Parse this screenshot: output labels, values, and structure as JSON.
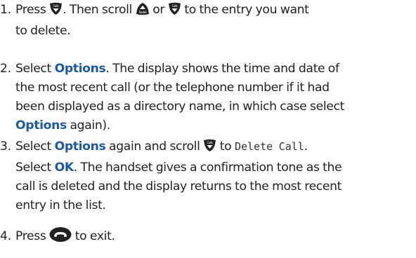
{
  "steps": [
    {
      "num": "1.",
      "line1a": "Press",
      "line1b": ". Then scroll",
      "line1c": "or",
      "line1d": "to the entry you want",
      "line2": "to delete."
    },
    {
      "num": "2.",
      "line1a": "Select",
      "kw1": "Options",
      "line1b": ". The display shows the time and date of",
      "line2": "the most recent call (or the telephone number if it had",
      "line3": "been displayed as a directory name, in which case select",
      "kw2": "Options",
      "line4b": "again)."
    },
    {
      "num": "3.",
      "line1a": "Select",
      "kw1": "Options",
      "line1b": "again and scroll",
      "line1c": "to",
      "lcd": "Delete Call",
      "line1d": ".",
      "line2a": "Select",
      "kw2": "OK",
      "line2b": ". The handset gives a confirmation tone as the",
      "line3": "call is deleted and the display returns to the most recent",
      "line4": "entry in the list."
    },
    {
      "num": "4.",
      "line1a": "Press",
      "line1b": "to exit."
    }
  ],
  "icons": {
    "calls": "Calls",
    "redial": "Redial"
  }
}
